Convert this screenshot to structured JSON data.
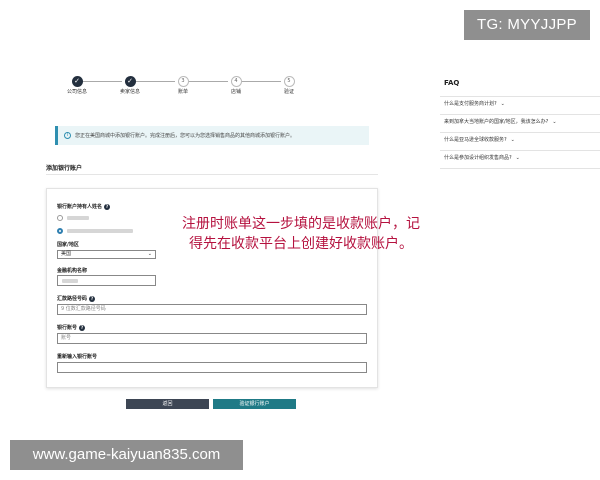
{
  "watermark_top": "TG: MYYJJPP",
  "watermark_bottom": "www.game-kaiyuan835.com",
  "stepper": {
    "steps": [
      {
        "num": "✓",
        "label": "公司信息",
        "done": true
      },
      {
        "num": "✓",
        "label": "卖家信息",
        "done": true
      },
      {
        "num": "3",
        "label": "账单",
        "done": false
      },
      {
        "num": "4",
        "label": "店铺",
        "done": false
      },
      {
        "num": "5",
        "label": "验证",
        "done": false
      }
    ]
  },
  "banner": {
    "text": "您正在美国商城中添加银行账户。完成注册后，您可以为您选择销售商品的其他商城添加银行账户。"
  },
  "section_title": "添加银行账户",
  "form": {
    "holder_label": "银行账户持有人姓名",
    "country_label": "国家/地区",
    "country_value": "美国",
    "institution_label": "金融机构名称",
    "routing_label": "汇款路径号码",
    "routing_placeholder": "9 位数汇款路径号码",
    "account_label": "银行账号",
    "account_placeholder": "账号",
    "reenter_label": "重新输入银行账号"
  },
  "buttons": {
    "back": "返回",
    "verify": "验证银行账户"
  },
  "annotation": "注册时账单这一步填的是收款账户，记得先在收款平台上创建好收款账户。",
  "faq": {
    "title": "FAQ",
    "items": [
      "什么是支付服务商计划?",
      "来到加拿大当地账户的国家/地区，我该怎么办?",
      "什么是亚马逊全球收款服务?",
      "什么是参加设计组织发售商品?"
    ]
  },
  "colors": {
    "accent_dark": "#232f3e",
    "teal": "#1f7a86",
    "annotation_red": "#b5123f"
  }
}
